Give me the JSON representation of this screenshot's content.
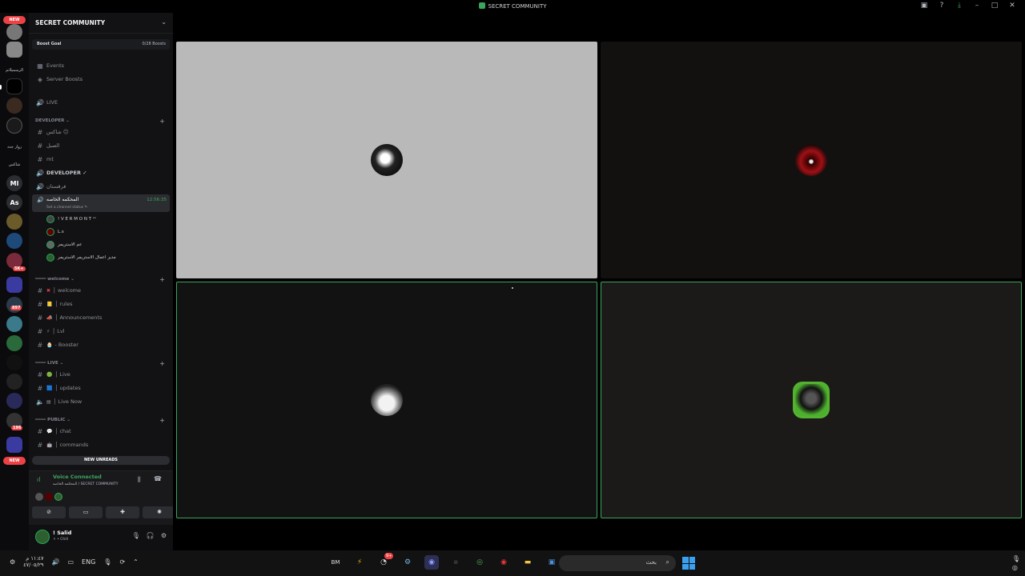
{
  "window": {
    "title": "SECRET COMMUNITY"
  },
  "rail": {
    "new_badge_top": "NEW",
    "new_badge_bottom": "NEW",
    "labels": [
      "الرسميلاتم",
      "زوار جدد",
      "شاكس"
    ],
    "text_servers": [
      "Ml",
      "As"
    ],
    "badges": [
      "5K+",
      "897",
      "196"
    ]
  },
  "server": {
    "name": "SECRET COMMUNITY",
    "boost_goal_label": "Boost Goal",
    "boost_goal_value": "0/28 Boosts"
  },
  "top_links": [
    {
      "label": "Events",
      "icon": "calendar-icon"
    },
    {
      "label": "Server Boosts",
      "icon": "boost-icon"
    }
  ],
  "live_channel": "LIVE",
  "developer_category": {
    "name": "DEVELOPER",
    "channels": [
      {
        "label": "شاكس 😑",
        "icon": "#"
      },
      {
        "label": "الصبل",
        "icon": "#"
      },
      {
        "label": "mt",
        "icon": "#"
      },
      {
        "label": "DEVELOPER ✓",
        "icon": "speaker"
      },
      {
        "label": "فرقستان",
        "icon": "speaker"
      }
    ]
  },
  "active_voice": {
    "name": "المحكمه الخاصه",
    "status": "Set a channel status ✎",
    "time": "12:56:35",
    "users": [
      "! V E R M O N T ᵘˢ",
      "L.s",
      "عم الاستريمر",
      "مدير اعمال الاستريمر الاستريمر"
    ]
  },
  "welcome_category": {
    "name": "━━━━ welcome",
    "channels": [
      {
        "label": "welcome",
        "emoji": "✖"
      },
      {
        "label": "rules",
        "emoji": "📒"
      },
      {
        "label": "Announcements",
        "emoji": "📣"
      },
      {
        "label": "Lvl",
        "emoji": "⚡"
      },
      {
        "label": "Booster",
        "emoji": "🧁"
      }
    ]
  },
  "live_category": {
    "name": "━━━━ LIVE",
    "channels": [
      {
        "label": "Live",
        "emoji": "🟢",
        "icon": "#"
      },
      {
        "label": "updates",
        "emoji": "🟦",
        "icon": "#"
      },
      {
        "label": "Live Now",
        "emoji": "▤",
        "icon": "speaker"
      }
    ]
  },
  "public_category": {
    "name": "━━━━ PUBLIC",
    "channels": [
      {
        "label": "chat",
        "emoji": "💬"
      },
      {
        "label": "commands",
        "emoji": "🤖"
      }
    ]
  },
  "new_unreads": "NEW UNREADS",
  "voice_panel": {
    "status": "Voice Connected",
    "location": "المحكمه الخاصه / SECRET COMMUNITY"
  },
  "user": {
    "name": "! Salid",
    "status": "⚪ • Chill"
  },
  "taskbar": {
    "time": "١١:٤٧ م",
    "date": "٤٧/٠٥/٢٩",
    "language": "ENG",
    "search_placeholder": "بحث",
    "notification_badge": "9+"
  },
  "colors": {
    "accent_green": "#3ba55c",
    "danger_red": "#ed4245"
  }
}
